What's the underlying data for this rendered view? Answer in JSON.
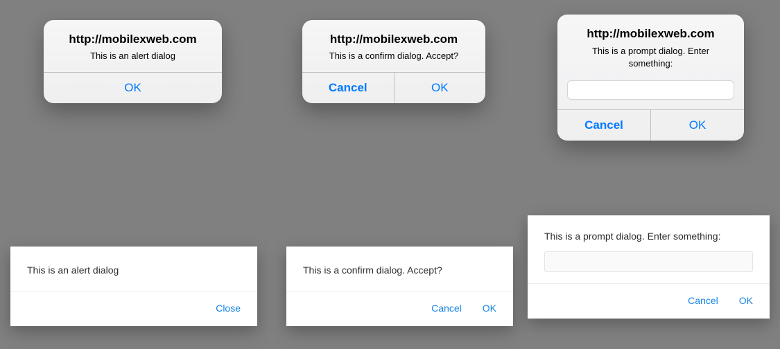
{
  "ios": {
    "alert": {
      "title": "http://mobilexweb.com",
      "message": "This is an alert dialog",
      "ok": "OK"
    },
    "confirm": {
      "title": "http://mobilexweb.com",
      "message": "This is a confirm dialog. Accept?",
      "cancel": "Cancel",
      "ok": "OK"
    },
    "prompt": {
      "title": "http://mobilexweb.com",
      "message": "This is a prompt dialog. Enter something:",
      "value": "",
      "cancel": "Cancel",
      "ok": "OK"
    }
  },
  "flat": {
    "alert": {
      "message": "This is an alert dialog",
      "close": "Close"
    },
    "confirm": {
      "message": "This is a confirm dialog. Accept?",
      "cancel": "Cancel",
      "ok": "OK"
    },
    "prompt": {
      "message": "This is a prompt dialog. Enter something:",
      "value": "",
      "cancel": "Cancel",
      "ok": "OK"
    }
  }
}
